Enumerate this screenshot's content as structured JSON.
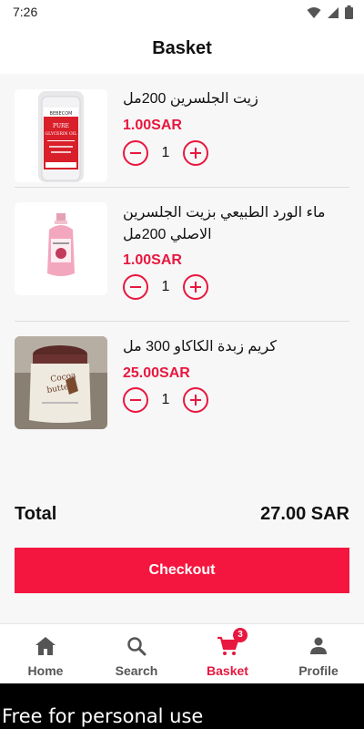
{
  "status_bar": {
    "time": "7:26",
    "icons": [
      "wifi-icon",
      "signal-icon",
      "battery-icon"
    ]
  },
  "header": {
    "title": "Basket"
  },
  "basket": {
    "items": [
      {
        "name": "زيت الجلسرين 200مل",
        "price": "1.00SAR",
        "quantity": "1",
        "image": "glycerin-oil-bottle"
      },
      {
        "name": "ماء الورد الطبيعي بزيت الجلسرين الاصلي 200مل",
        "price": "1.00SAR",
        "quantity": "1",
        "image": "rose-water-bottle"
      },
      {
        "name": "كريم زبدة الكاكاو 300 مل",
        "price": "25.00SAR",
        "quantity": "1",
        "image": "cocoa-butter-jar"
      }
    ]
  },
  "summary": {
    "total_label": "Total",
    "total_value": "27.00 SAR"
  },
  "checkout": {
    "label": "Checkout"
  },
  "bottom_nav": {
    "items": [
      {
        "label": "Home",
        "icon": "home-icon",
        "active": false
      },
      {
        "label": "Search",
        "icon": "search-icon",
        "active": false
      },
      {
        "label": "Basket",
        "icon": "cart-icon",
        "active": true,
        "badge": "3"
      },
      {
        "label": "Profile",
        "icon": "person-icon",
        "active": false
      }
    ]
  },
  "watermark": {
    "text": "Free for personal use"
  },
  "colors": {
    "accent": "#f5163f",
    "price": "#e8173f",
    "background": "#f7f7f7"
  }
}
